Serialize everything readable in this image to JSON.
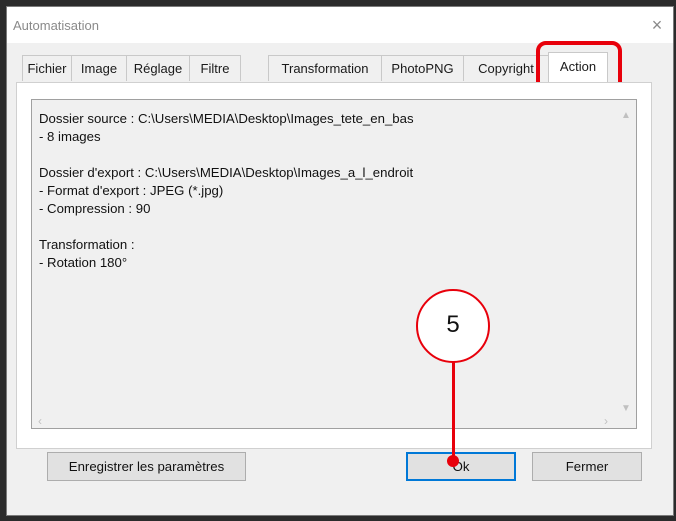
{
  "window": {
    "title": "Automatisation",
    "close_icon": "×"
  },
  "tabs": [
    {
      "label": "Fichier"
    },
    {
      "label": "Image"
    },
    {
      "label": "Réglage"
    },
    {
      "label": "Filtre"
    },
    {
      "label": "Transformation"
    },
    {
      "label": "PhotoPNG"
    },
    {
      "label": "Copyright"
    },
    {
      "label": "Action",
      "active": true
    }
  ],
  "summary": {
    "lines": [
      "Dossier source : C:\\Users\\MEDIA\\Desktop\\Images_tete_en_bas",
      "- 8 images",
      "",
      "Dossier d'export : C:\\Users\\MEDIA\\Desktop\\Images_a_l_endroit",
      "- Format d'export : JPEG (*.jpg)",
      "- Compression : 90",
      "",
      "Transformation :",
      "- Rotation 180°"
    ]
  },
  "buttons": {
    "save_settings": "Enregistrer les paramètres",
    "ok": "Ok",
    "close": "Fermer"
  },
  "annotation": {
    "step_number": "5",
    "color": "#e8000b"
  },
  "colors": {
    "highlight": "#e8000b",
    "default_button_border": "#0078d7"
  }
}
